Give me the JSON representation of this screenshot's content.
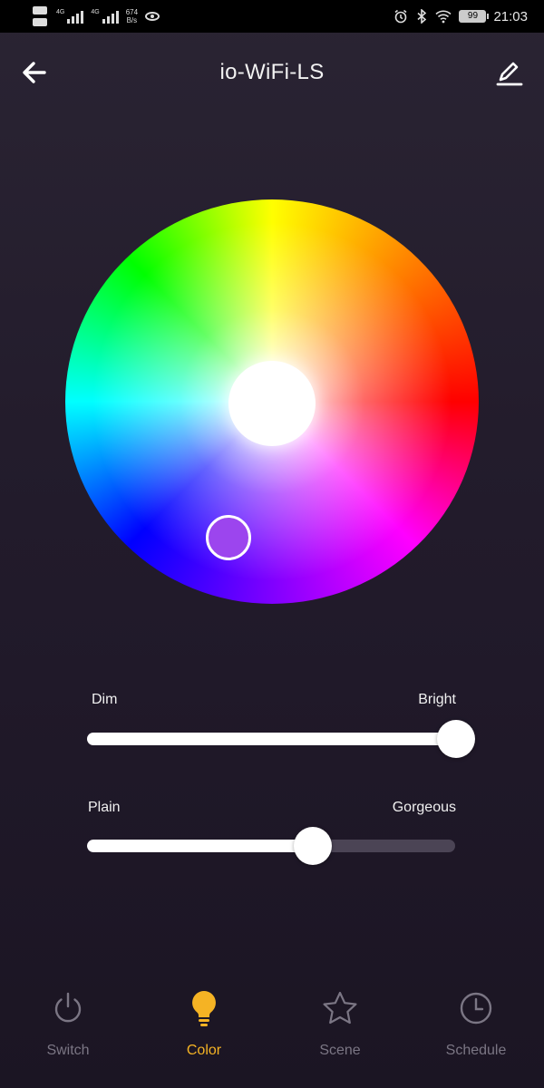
{
  "status_bar": {
    "signal_tag_1": "4G",
    "signal_tag_2": "4G",
    "speed_value": "674",
    "speed_unit": "B/s",
    "battery": "99",
    "time": "21:03"
  },
  "header": {
    "title": "io-WiFi-LS"
  },
  "color_wheel": {
    "selected_color": "#9c45ee"
  },
  "brightness_slider": {
    "min_label": "Dim",
    "max_label": "Bright",
    "value_percent": 100
  },
  "saturation_slider": {
    "min_label": "Plain",
    "max_label": "Gorgeous",
    "value_percent": 61
  },
  "bottom_nav": {
    "items": [
      {
        "label": "Switch",
        "icon": "power-icon",
        "active": false
      },
      {
        "label": "Color",
        "icon": "bulb-icon",
        "active": true
      },
      {
        "label": "Scene",
        "icon": "star-icon",
        "active": false
      },
      {
        "label": "Schedule",
        "icon": "clock-icon",
        "active": false
      }
    ]
  },
  "colors": {
    "accent": "#f5b324",
    "inactive": "#7b7684",
    "background": "#231c2c"
  }
}
